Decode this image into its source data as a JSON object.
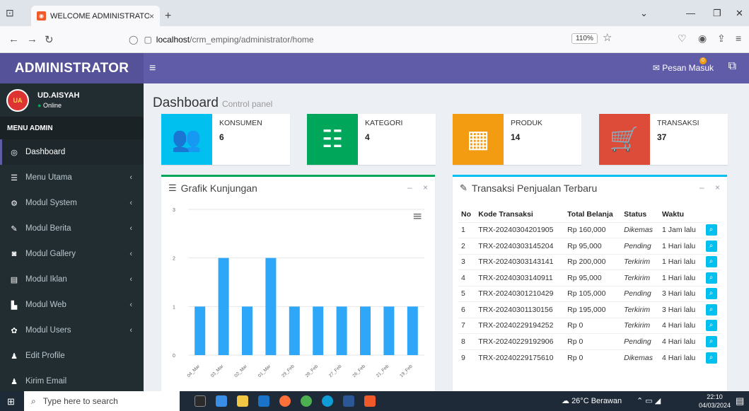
{
  "browser": {
    "tab_title": "WELCOME ADMINISTRATOR",
    "tab_close": "×",
    "new_tab": "+",
    "url_host": "localhost",
    "url_path": "/crm_emping/administrator/home",
    "zoom": "110%"
  },
  "header": {
    "logo": "ADMINISTRATOR",
    "messages_label": "Pesan Masuk",
    "messages_count": "0"
  },
  "user": {
    "avatar_text": "UA",
    "name": "UD.AISYAH",
    "status": "Online"
  },
  "sidebar": {
    "header": "MENU ADMIN",
    "items": [
      {
        "label": "Dashboard",
        "icon": "dashboard-icon",
        "glyph": "◎",
        "active": true,
        "caret": ""
      },
      {
        "label": "Menu Utama",
        "icon": "table-icon",
        "glyph": "☰",
        "caret": "‹"
      },
      {
        "label": "Modul System",
        "icon": "cogs-icon",
        "glyph": "⚙",
        "caret": "‹"
      },
      {
        "label": "Modul Berita",
        "icon": "pencil-icon",
        "glyph": "✎",
        "caret": "‹"
      },
      {
        "label": "Modul Gallery",
        "icon": "camera-icon",
        "glyph": "◙",
        "caret": "‹"
      },
      {
        "label": "Modul Iklan",
        "icon": "newspaper-icon",
        "glyph": "▤",
        "caret": "‹"
      },
      {
        "label": "Modul Web",
        "icon": "web-icon",
        "glyph": "▙",
        "caret": "‹"
      },
      {
        "label": "Modul Users",
        "icon": "gear-icon",
        "glyph": "✿",
        "caret": "‹"
      },
      {
        "label": "Edit Profile",
        "icon": "user-icon",
        "glyph": "♟",
        "caret": ""
      },
      {
        "label": "Kirim Email",
        "icon": "user-icon",
        "glyph": "♟",
        "caret": ""
      }
    ]
  },
  "page": {
    "title": "Dashboard",
    "subtitle": "Control panel"
  },
  "info_boxes": [
    {
      "label": "KONSUMEN",
      "value": "6",
      "color": "#00c0ef",
      "icon": "users-icon",
      "glyph": "👥"
    },
    {
      "label": "KATEGORI",
      "value": "4",
      "color": "#00a65a",
      "icon": "list-icon",
      "glyph": "☷"
    },
    {
      "label": "PRODUK",
      "value": "14",
      "color": "#f39c12",
      "icon": "grid-icon",
      "glyph": "▦"
    },
    {
      "label": "TRANSAKSI",
      "value": "37",
      "color": "#dd4b39",
      "icon": "cart-icon",
      "glyph": "🛒"
    }
  ],
  "chart_box": {
    "title": "Grafik Kunjungan",
    "minimize": "–",
    "close": "×"
  },
  "chart_data": {
    "type": "bar",
    "categories": [
      "04_Mar",
      "03_Mar",
      "02_Mar",
      "01_Mar",
      "29_Feb",
      "28_Feb",
      "27_Feb",
      "26_Feb",
      "21_Feb",
      "19_Feb"
    ],
    "values": [
      1,
      2,
      1,
      2,
      1,
      1,
      1,
      1,
      1,
      1
    ],
    "y_ticks": [
      "0",
      "1",
      "2",
      "3"
    ],
    "ylim": [
      0,
      3
    ],
    "color": "#2ea7f8",
    "grid": true
  },
  "trx_box": {
    "title": "Transaksi Penjualan Terbaru",
    "minimize": "–",
    "close": "×",
    "columns": [
      "No",
      "Kode Transaksi",
      "Total Belanja",
      "Status",
      "Waktu"
    ],
    "rows": [
      {
        "no": "1",
        "kode": "TRX-20240304201905",
        "total": "Rp 160,000",
        "status": "Dikemas",
        "waktu": "1 Jam lalu"
      },
      {
        "no": "2",
        "kode": "TRX-20240303145204",
        "total": "Rp 95,000",
        "status": "Pending",
        "waktu": "1 Hari lalu"
      },
      {
        "no": "3",
        "kode": "TRX-20240303143141",
        "total": "Rp 200,000",
        "status": "Terkirim",
        "waktu": "1 Hari lalu"
      },
      {
        "no": "4",
        "kode": "TRX-20240303140911",
        "total": "Rp 95,000",
        "status": "Terkirim",
        "waktu": "1 Hari lalu"
      },
      {
        "no": "5",
        "kode": "TRX-20240301210429",
        "total": "Rp 105,000",
        "status": "Pending",
        "waktu": "3 Hari lalu"
      },
      {
        "no": "6",
        "kode": "TRX-20240301130156",
        "total": "Rp 195,000",
        "status": "Terkirim",
        "waktu": "3 Hari lalu"
      },
      {
        "no": "7",
        "kode": "TRX-20240229194252",
        "total": "Rp 0",
        "status": "Terkirim",
        "waktu": "4 Hari lalu"
      },
      {
        "no": "8",
        "kode": "TRX-20240229192906",
        "total": "Rp 0",
        "status": "Pending",
        "waktu": "4 Hari lalu"
      },
      {
        "no": "9",
        "kode": "TRX-20240229175610",
        "total": "Rp 0",
        "status": "Dikemas",
        "waktu": "4 Hari lalu"
      }
    ]
  },
  "taskbar": {
    "search_placeholder": "Type here to search",
    "weather": "26°C  Berawan",
    "time": "22:10",
    "date": "04/03/2024"
  }
}
